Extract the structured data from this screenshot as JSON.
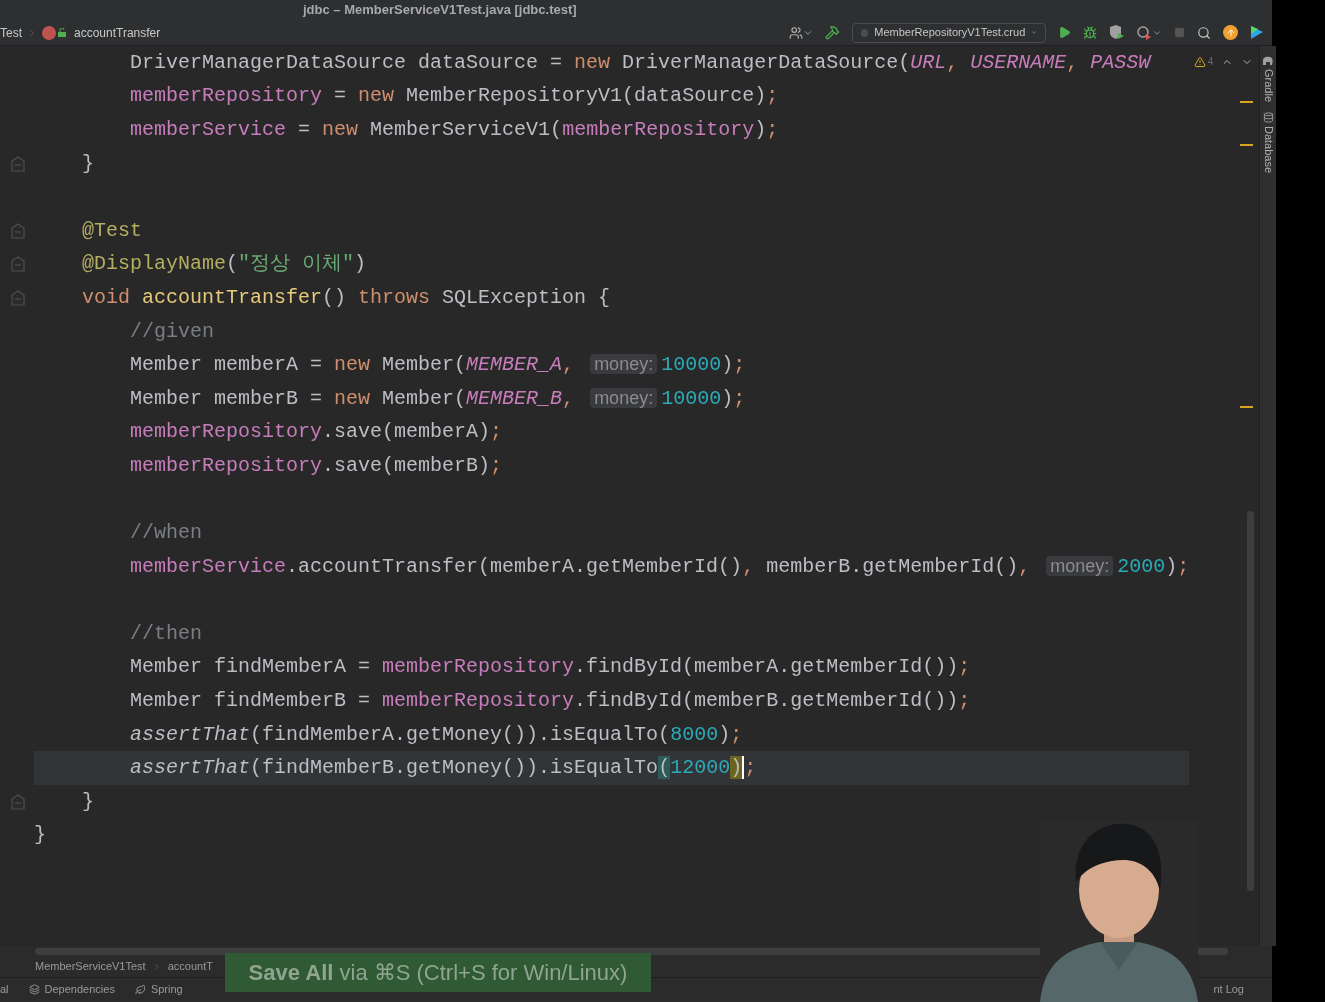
{
  "window": {
    "title": "jdbc – MemberServiceV1Test.java [jdbc.test]"
  },
  "navbar": {
    "breadcrumb": [
      "Test",
      "accountTransfer"
    ],
    "run_configuration": "MemberRepositoryV1Test.crud"
  },
  "editor": {
    "warning_count": "4",
    "lines": [
      {
        "fold": false,
        "current": false,
        "tokens": [
          {
            "kind": "plain",
            "text": "        DriverManagerDataSource dataSource = "
          },
          {
            "kind": "keyword",
            "text": "new"
          },
          {
            "kind": "plain",
            "text": " DriverManagerDataSource("
          },
          {
            "kind": "static",
            "text": "URL"
          },
          {
            "kind": "keyword",
            "text": ", "
          },
          {
            "kind": "static",
            "text": "USERNAME"
          },
          {
            "kind": "keyword",
            "text": ", "
          },
          {
            "kind": "static",
            "text": "PASSW"
          }
        ]
      },
      {
        "fold": false,
        "current": false,
        "tokens": [
          {
            "kind": "field",
            "text": "        memberRepository"
          },
          {
            "kind": "plain",
            "text": " = "
          },
          {
            "kind": "keyword",
            "text": "new"
          },
          {
            "kind": "plain",
            "text": " MemberRepositoryV1(dataSource)"
          },
          {
            "kind": "keyword",
            "text": ";"
          }
        ]
      },
      {
        "fold": false,
        "current": false,
        "tokens": [
          {
            "kind": "field",
            "text": "        memberService"
          },
          {
            "kind": "plain",
            "text": " = "
          },
          {
            "kind": "keyword",
            "text": "new"
          },
          {
            "kind": "plain",
            "text": " MemberServiceV1("
          },
          {
            "kind": "field",
            "text": "memberRepository"
          },
          {
            "kind": "plain",
            "text": ")"
          },
          {
            "kind": "keyword",
            "text": ";"
          }
        ]
      },
      {
        "fold": true,
        "current": false,
        "tokens": [
          {
            "kind": "plain",
            "text": "    }"
          }
        ]
      },
      {
        "fold": false
      },
      {
        "fold": true,
        "current": false,
        "tokens": [
          {
            "kind": "annotation",
            "text": "    @Test"
          }
        ]
      },
      {
        "fold": true,
        "current": false,
        "tokens": [
          {
            "kind": "annotation",
            "text": "    @DisplayName"
          },
          {
            "kind": "plain",
            "text": "("
          },
          {
            "kind": "string",
            "text": "\"정상 이체\""
          },
          {
            "kind": "plain",
            "text": ")"
          }
        ]
      },
      {
        "fold": true,
        "current": false,
        "tokens": [
          {
            "kind": "keyword",
            "text": "    void"
          },
          {
            "kind": "method",
            "text": " accountTransfer"
          },
          {
            "kind": "plain",
            "text": "() "
          },
          {
            "kind": "keyword",
            "text": "throws"
          },
          {
            "kind": "plain",
            "text": " SQLException {"
          }
        ]
      },
      {
        "fold": false,
        "current": false,
        "tokens": [
          {
            "kind": "comment",
            "text": "        //given"
          }
        ]
      },
      {
        "fold": false,
        "current": false,
        "tokens": [
          {
            "kind": "plain",
            "text": "        Member memberA = "
          },
          {
            "kind": "keyword",
            "text": "new"
          },
          {
            "kind": "plain",
            "text": " Member("
          },
          {
            "kind": "static",
            "text": "MEMBER_A"
          },
          {
            "kind": "keyword",
            "text": ", "
          },
          {
            "kind": "hint",
            "text": "money:"
          },
          {
            "kind": "number",
            "text": "10000"
          },
          {
            "kind": "plain",
            "text": ")"
          },
          {
            "kind": "keyword",
            "text": ";"
          }
        ]
      },
      {
        "fold": false,
        "current": false,
        "tokens": [
          {
            "kind": "plain",
            "text": "        Member memberB = "
          },
          {
            "kind": "keyword",
            "text": "new"
          },
          {
            "kind": "plain",
            "text": " Member("
          },
          {
            "kind": "static",
            "text": "MEMBER_B"
          },
          {
            "kind": "keyword",
            "text": ", "
          },
          {
            "kind": "hint",
            "text": "money:"
          },
          {
            "kind": "number",
            "text": "10000"
          },
          {
            "kind": "plain",
            "text": ")"
          },
          {
            "kind": "keyword",
            "text": ";"
          }
        ]
      },
      {
        "fold": false,
        "current": false,
        "tokens": [
          {
            "kind": "field",
            "text": "        memberRepository"
          },
          {
            "kind": "plain",
            "text": ".save(memberA)"
          },
          {
            "kind": "keyword",
            "text": ";"
          }
        ]
      },
      {
        "fold": false,
        "current": false,
        "tokens": [
          {
            "kind": "field",
            "text": "        memberRepository"
          },
          {
            "kind": "plain",
            "text": ".save(memberB)"
          },
          {
            "kind": "keyword",
            "text": ";"
          }
        ]
      },
      {
        "fold": false
      },
      {
        "fold": false,
        "current": false,
        "tokens": [
          {
            "kind": "comment",
            "text": "        //when"
          }
        ]
      },
      {
        "fold": false,
        "current": false,
        "tokens": [
          {
            "kind": "field",
            "text": "        memberService"
          },
          {
            "kind": "plain",
            "text": ".accountTransfer(memberA.getMemberId()"
          },
          {
            "kind": "keyword",
            "text": ","
          },
          {
            "kind": "plain",
            "text": " memberB.getMemberId()"
          },
          {
            "kind": "keyword",
            "text": ", "
          },
          {
            "kind": "hint",
            "text": "money:"
          },
          {
            "kind": "number",
            "text": "2000"
          },
          {
            "kind": "plain",
            "text": ")"
          },
          {
            "kind": "keyword",
            "text": ";"
          }
        ]
      },
      {
        "fold": false
      },
      {
        "fold": false,
        "current": false,
        "tokens": [
          {
            "kind": "comment",
            "text": "        //then"
          }
        ]
      },
      {
        "fold": false,
        "current": false,
        "tokens": [
          {
            "kind": "plain",
            "text": "        Member findMemberA = "
          },
          {
            "kind": "field",
            "text": "memberRepository"
          },
          {
            "kind": "plain",
            "text": ".findById(memberA.getMemberId())"
          },
          {
            "kind": "keyword",
            "text": ";"
          }
        ]
      },
      {
        "fold": false,
        "current": false,
        "tokens": [
          {
            "kind": "plain",
            "text": "        Member findMemberB = "
          },
          {
            "kind": "field",
            "text": "memberRepository"
          },
          {
            "kind": "plain",
            "text": ".findById(memberB.getMemberId())"
          },
          {
            "kind": "keyword",
            "text": ";"
          }
        ]
      },
      {
        "fold": false,
        "current": false,
        "tokens": [
          {
            "kind": "italic",
            "text": "        assertThat"
          },
          {
            "kind": "plain",
            "text": "(findMemberA.getMoney()).isEqualTo("
          },
          {
            "kind": "number",
            "text": "8000"
          },
          {
            "kind": "plain",
            "text": ")"
          },
          {
            "kind": "keyword",
            "text": ";"
          }
        ]
      },
      {
        "fold": false,
        "current": true,
        "tokens": [
          {
            "kind": "italic",
            "text": "        assertThat"
          },
          {
            "kind": "plain",
            "text": "(findMemberB.getMoney()).isEqualTo"
          },
          {
            "kind": "bracket",
            "text": "("
          },
          {
            "kind": "number",
            "text": "12000"
          },
          {
            "kind": "caret-bracket",
            "text": ")"
          },
          {
            "kind": "keyword",
            "text": ";"
          }
        ]
      },
      {
        "fold": true,
        "current": false,
        "tokens": [
          {
            "kind": "plain",
            "text": "    }"
          }
        ]
      },
      {
        "fold": false,
        "current": false,
        "tokens": [
          {
            "kind": "plain",
            "text": "}"
          }
        ]
      }
    ]
  },
  "tool_strip": [
    "Gradle",
    "Database"
  ],
  "bottom_breadcrumb": [
    "MemberServiceV1Test",
    "accountT"
  ],
  "tool_tabs": [
    {
      "kind": "plain",
      "label": "al"
    },
    {
      "kind": "dependencies",
      "label": "Dependencies"
    },
    {
      "kind": "spring",
      "label": "Spring"
    },
    {
      "kind": "plain",
      "label": "nt Log"
    }
  ],
  "notification": {
    "text": "**Save All** via ⌘S (Ctrl+S for Win/Linux)"
  },
  "webcam": {
    "kind": "picture"
  }
}
